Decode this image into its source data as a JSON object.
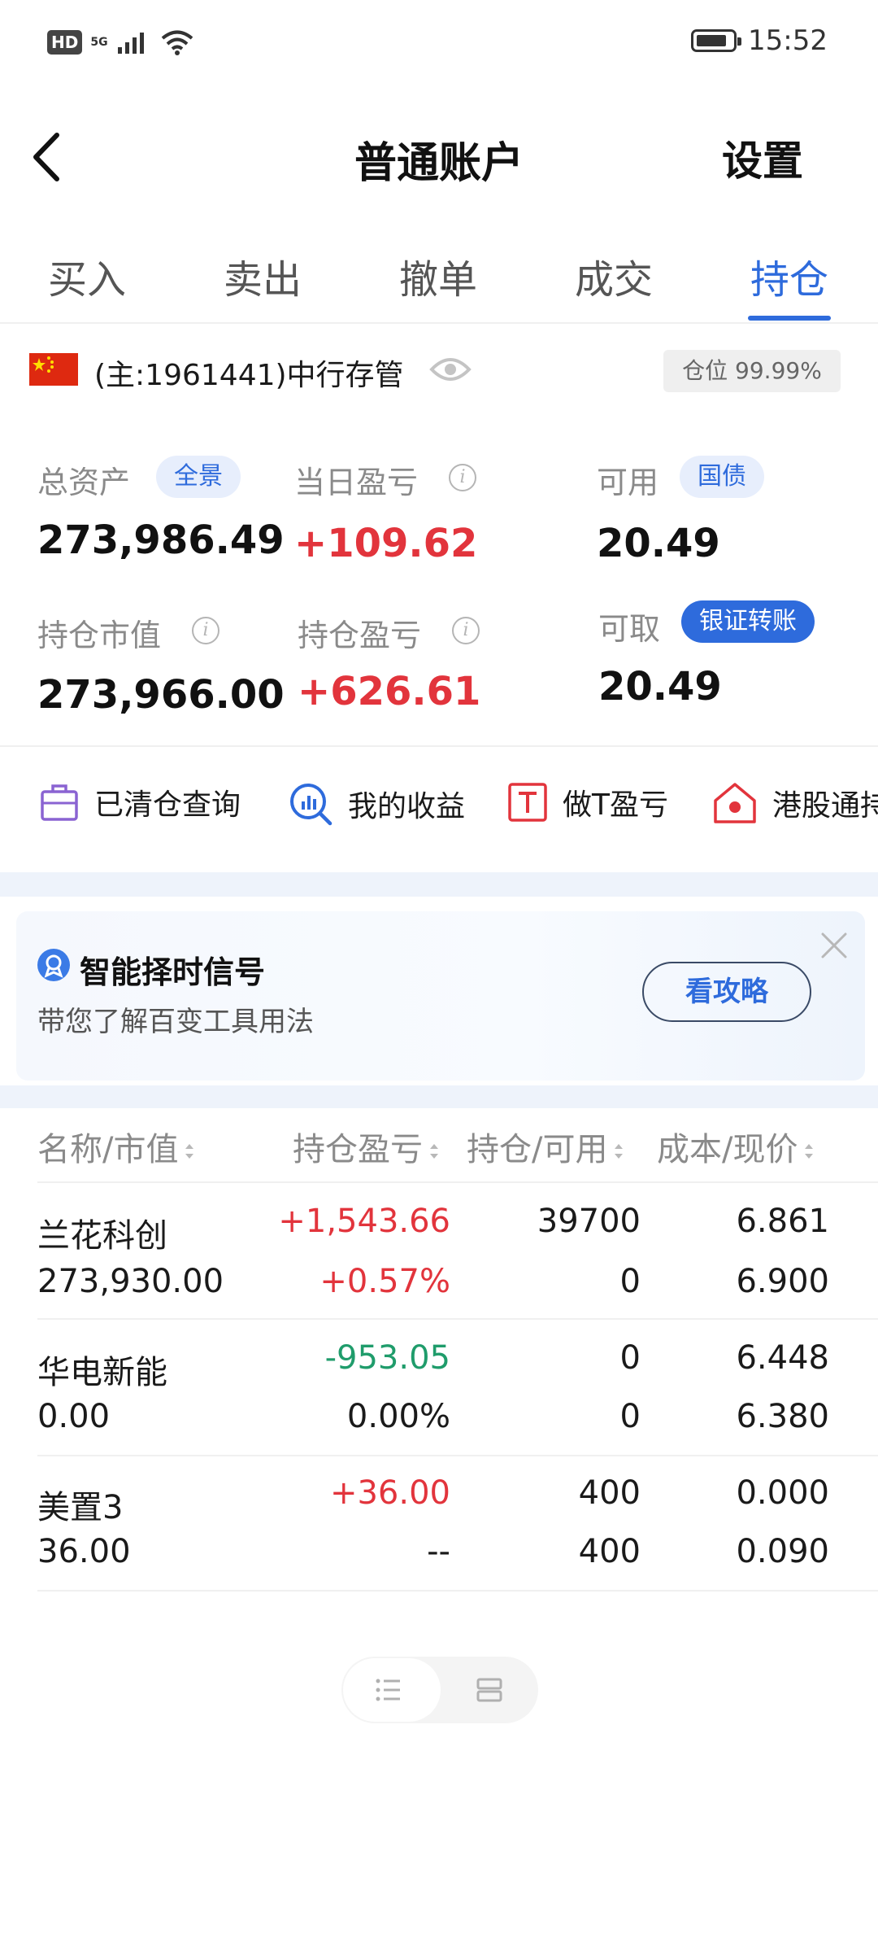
{
  "status_bar": {
    "hd": "HD",
    "network": "5G",
    "time": "15:52"
  },
  "nav": {
    "title": "普通账户",
    "settings_label": "设置"
  },
  "tabs": [
    {
      "label": "买入"
    },
    {
      "label": "卖出"
    },
    {
      "label": "撤单"
    },
    {
      "label": "成交"
    },
    {
      "label": "持仓",
      "active": true
    }
  ],
  "account": {
    "name": "(主:1961441)中行存管",
    "position_badge": "仓位 99.99%"
  },
  "summary": {
    "total_assets_label": "总资产",
    "total_assets_pill": "全景",
    "total_assets_value": "273,986.49",
    "daily_pnl_label": "当日盈亏",
    "daily_pnl_value": "+109.62",
    "available_label": "可用",
    "available_pill": "国债",
    "available_value": "20.49",
    "market_value_label": "持仓市值",
    "market_value_value": "273,966.00",
    "position_pnl_label": "持仓盈亏",
    "position_pnl_value": "+626.61",
    "withdrawable_label": "可取",
    "withdrawable_pill": "银证转账",
    "withdrawable_value": "20.49"
  },
  "quick_actions": [
    {
      "label": "已清仓查询",
      "icon": "briefcase-icon"
    },
    {
      "label": "我的收益",
      "icon": "chart-search-icon"
    },
    {
      "label": "做T盈亏",
      "icon": "t-box-icon"
    },
    {
      "label": "港股通持",
      "icon": "hk-home-icon"
    }
  ],
  "promo": {
    "title": "智能择时信号",
    "subtitle": "带您了解百变工具用法",
    "button_label": "看攻略"
  },
  "table": {
    "headers": [
      "名称/市值",
      "持仓盈亏",
      "持仓/可用",
      "成本/现价"
    ],
    "rows": [
      {
        "name": "兰花科创",
        "market_value": "273,930.00",
        "pnl": "+1,543.66",
        "pnl_pct": "+0.57%",
        "holding": "39700",
        "available": "0",
        "cost": "6.861",
        "price": "6.900",
        "pnl_color": "red",
        "pct_color": "red"
      },
      {
        "name": "华电新能",
        "market_value": "0.00",
        "pnl": "-953.05",
        "pnl_pct": "0.00%",
        "holding": "0",
        "available": "0",
        "cost": "6.448",
        "price": "6.380",
        "pnl_color": "green",
        "pct_color": "plain"
      },
      {
        "name": "美置3",
        "market_value": "36.00",
        "pnl": "+36.00",
        "pnl_pct": "--",
        "holding": "400",
        "available": "400",
        "cost": "0.000",
        "price": "0.090",
        "pnl_color": "red",
        "pct_color": "plain"
      }
    ]
  },
  "colors": {
    "accent": "#2e6bdc",
    "up": "#e2343c",
    "down": "#1f9c6b"
  }
}
